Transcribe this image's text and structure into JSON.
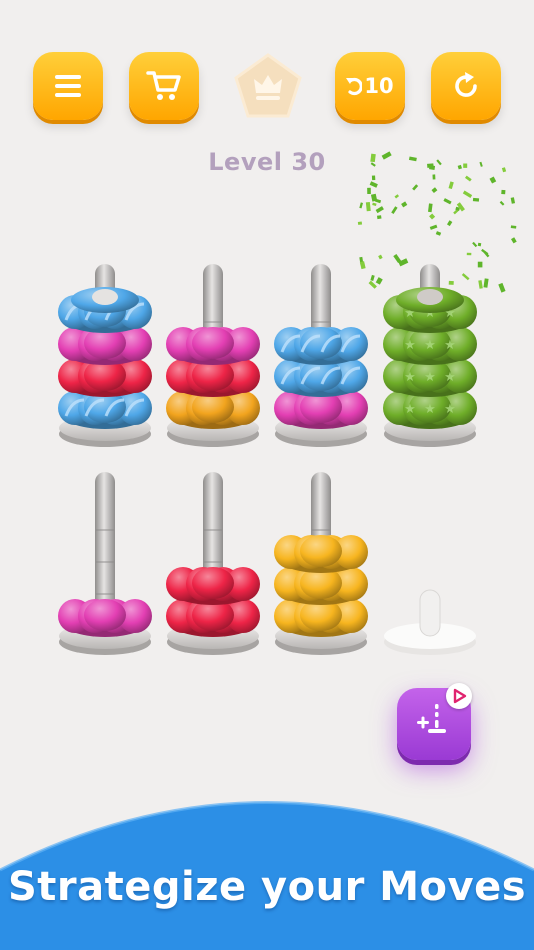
{
  "toolbar": {
    "menu_icon": "menu-icon",
    "shop_icon": "cart-icon",
    "crown_icon": "crown-icon",
    "undo_icon": "undo-icon",
    "undo_count": "10",
    "restart_icon": "restart-icon"
  },
  "level": {
    "label": "Level 30"
  },
  "colors": {
    "blue": "#4fa7e8",
    "pink": "#e33fb3",
    "red": "#ee2447",
    "orange": "#f2a41e",
    "green": "#6fae29",
    "yellow": "#f7b51f",
    "button": "#ffb31a",
    "add_button": "#b04ee2",
    "banner": "#2c8fe6"
  },
  "poles": [
    {
      "rings": [
        "blue",
        "red",
        "pink",
        "blue"
      ],
      "cap": "blue"
    },
    {
      "rings": [
        "orange",
        "red",
        "pink"
      ]
    },
    {
      "rings": [
        "pink",
        "blue",
        "blue"
      ]
    },
    {
      "rings": [
        "green",
        "green",
        "green",
        "green"
      ],
      "cap": "green",
      "completed": true
    },
    {
      "rings": [
        "pink"
      ]
    },
    {
      "rings": [
        "red",
        "red"
      ]
    },
    {
      "rings": [
        "yellow",
        "yellow",
        "yellow"
      ]
    },
    {
      "rings": []
    }
  ],
  "add_pole_button": {
    "icon": "add-pole-icon",
    "badge_icon": "video-ad-icon"
  },
  "banner": {
    "text": "Strategize your Moves"
  }
}
